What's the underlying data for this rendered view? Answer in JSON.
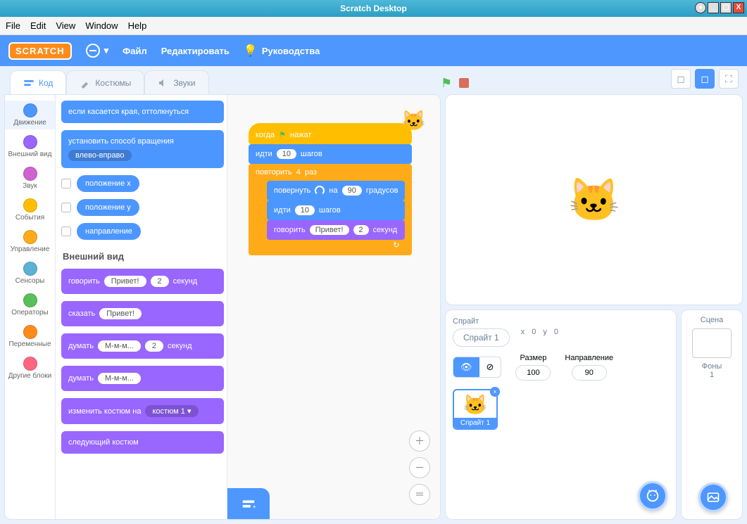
{
  "window": {
    "title": "Scratch Desktop"
  },
  "menubar": {
    "file": "File",
    "edit": "Edit",
    "view": "View",
    "window": "Window",
    "help": "Help"
  },
  "topnav": {
    "logo": "SCRATCH",
    "file": "Файл",
    "edit": "Редактировать",
    "tutorials": "Руководства"
  },
  "tabs": {
    "code": "Код",
    "costumes": "Костюмы",
    "sounds": "Звуки"
  },
  "categories": [
    {
      "name": "Движение",
      "color": "#4c97ff"
    },
    {
      "name": "Внешний вид",
      "color": "#9966ff"
    },
    {
      "name": "Звук",
      "color": "#cf63cf"
    },
    {
      "name": "События",
      "color": "#ffbf00"
    },
    {
      "name": "Управление",
      "color": "#ffab19"
    },
    {
      "name": "Сенсоры",
      "color": "#5cb1d6"
    },
    {
      "name": "Операторы",
      "color": "#59c059"
    },
    {
      "name": "Переменные",
      "color": "#ff8c1a"
    },
    {
      "name": "Другие блоки",
      "color": "#ff6680"
    }
  ],
  "palette": {
    "bounce": "если касается края, оттолкнуться",
    "setrot_pre": "установить способ вращения",
    "setrot_val": "влево-вправо",
    "var_x": "положение x",
    "var_y": "положение y",
    "var_dir": "направление",
    "looks_header": "Внешний вид",
    "say_for_pre": "говорить",
    "say_for_val": "Привет!",
    "say_for_n": "2",
    "say_for_post": "секунд",
    "say_pre": "сказать",
    "say_val": "Привет!",
    "think_for_pre": "думать",
    "think_for_val": "М-м-м...",
    "think_for_n": "2",
    "think_for_post": "секунд",
    "think_pre": "думать",
    "think_val": "М-м-м...",
    "switch_pre": "изменить костюм на",
    "switch_val": "костюм 1 ▾",
    "next_cost": "следующий костюм"
  },
  "script": {
    "when": "когда",
    "clicked": "нажат",
    "move_pre": "идти",
    "move_n": "10",
    "move_post": "шагов",
    "repeat_pre": "повторить",
    "repeat_n": "4",
    "repeat_post": "раз",
    "turn_pre": "повернуть",
    "turn_by": "на",
    "turn_n": "90",
    "turn_post": "градусов",
    "move2_pre": "идти",
    "move2_n": "10",
    "move2_post": "шагов",
    "say_pre": "говорить",
    "say_val": "Привет!",
    "say_n": "2",
    "say_post": "секунд"
  },
  "sprite": {
    "label": "Спрайт",
    "name": "Спрайт 1",
    "x_label": "x",
    "x": "0",
    "y_label": "y",
    "y": "0",
    "size_label": "Размер",
    "size": "100",
    "dir_label": "Направление",
    "dir": "90",
    "thumb": "Спрайт 1"
  },
  "scene": {
    "label": "Сцена",
    "backdrops_label": "Фоны",
    "backdrops_n": "1"
  }
}
